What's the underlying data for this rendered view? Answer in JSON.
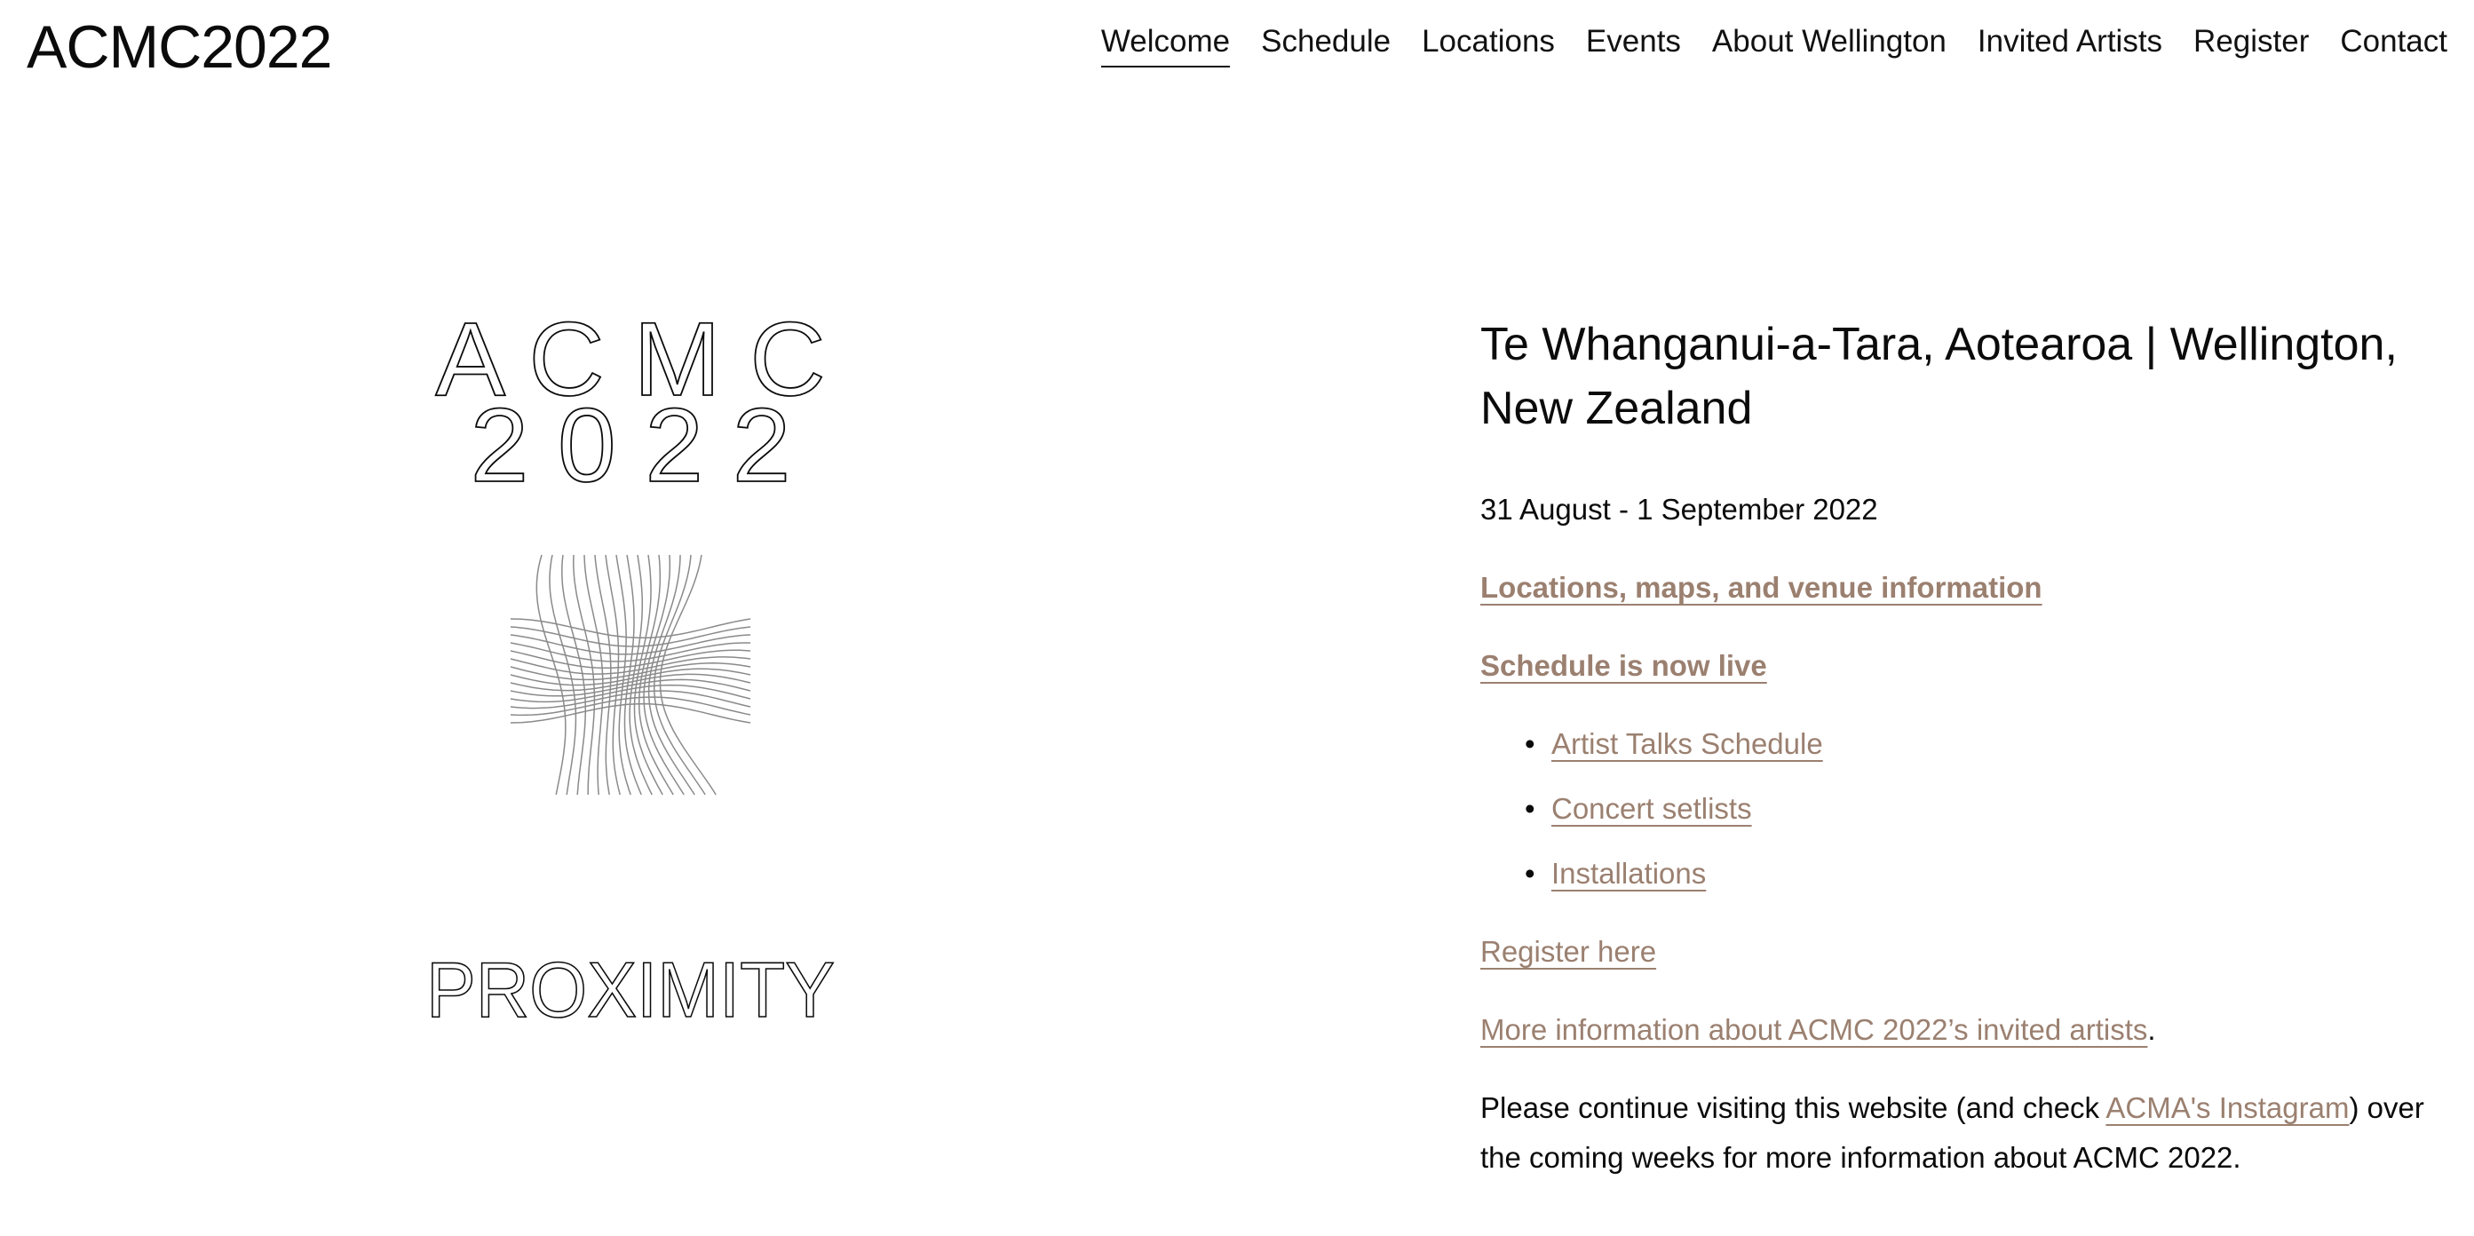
{
  "site": {
    "title": "ACMC2022"
  },
  "nav": {
    "items": [
      {
        "label": "Welcome"
      },
      {
        "label": "Schedule"
      },
      {
        "label": "Locations"
      },
      {
        "label": "Events"
      },
      {
        "label": "About Wellington"
      },
      {
        "label": "Invited Artists"
      },
      {
        "label": "Register"
      },
      {
        "label": "Contact"
      }
    ],
    "active": "Welcome"
  },
  "logo": {
    "line1": "A C M C",
    "line2": "2 0 2 2",
    "tagline": "PROXIMITY"
  },
  "main": {
    "heading": "Te Whanganui-a-Tara,  Aotearoa | Wellington, New Zealand",
    "dates": "31 August - 1 September 2022",
    "locations_link": "Locations, maps, and venue information",
    "schedule_link": "Schedule is now live",
    "schedule_items": [
      {
        "label": "Artist Talks Schedule"
      },
      {
        "label": "Concert setlists"
      },
      {
        "label": "Installations"
      }
    ],
    "register_link": "Register here",
    "invited_link": "More information about ACMC 2022’s invited artists",
    "invited_suffix": ".",
    "closing_prefix": "Please continue visiting this website (and check ",
    "instagram_link": "ACMA's Instagram",
    "closing_suffix": ") over the coming weeks for more information about ACMC 2022."
  },
  "colors": {
    "text": "#0b0b0b",
    "accent_link": "#9b8070",
    "background": "#ffffff",
    "logo_lines": "#8a8a8a"
  }
}
